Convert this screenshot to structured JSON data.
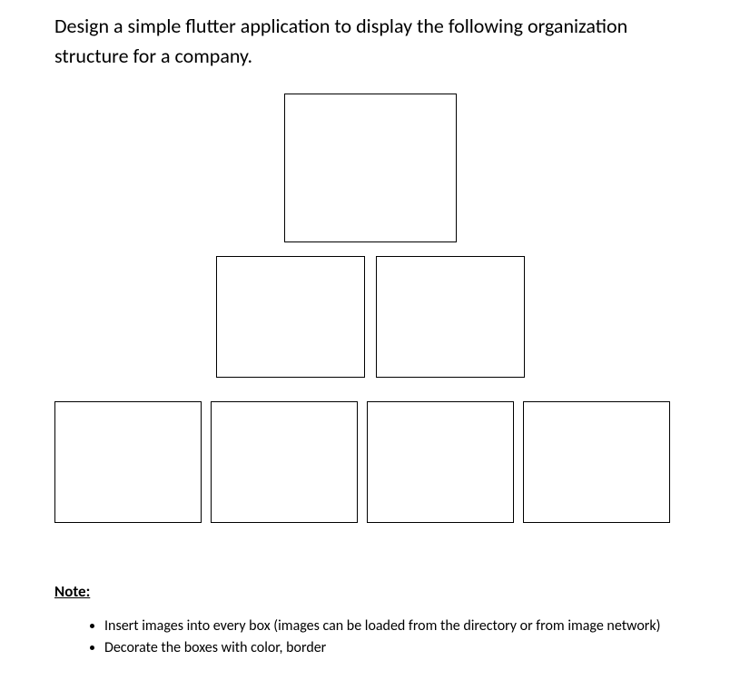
{
  "prompt_text": "Design a simple flutter application to display the following organization structure for a company.",
  "note": {
    "heading": "Note:",
    "items": [
      "Insert images into every box (images can be loaded from the directory or from image network)",
      "Decorate the  boxes with color, border"
    ]
  }
}
